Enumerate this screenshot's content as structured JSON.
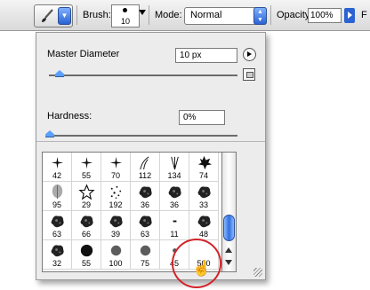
{
  "options_bar": {
    "brush_label": "Brush:",
    "brush_size": "10",
    "mode_label": "Mode:",
    "mode_value": "Normal",
    "opacity_label": "Opacity:",
    "opacity_value": "100%",
    "flow_label": "F"
  },
  "picker": {
    "master_diameter_label": "Master Diameter",
    "master_diameter_value": "10 px",
    "hardness_label": "Hardness:",
    "hardness_value": "0%"
  },
  "brushes": [
    {
      "num": "42",
      "kind": "star-small"
    },
    {
      "num": "55",
      "kind": "star-small"
    },
    {
      "num": "70",
      "kind": "star-small"
    },
    {
      "num": "112",
      "kind": "grass"
    },
    {
      "num": "134",
      "kind": "grass2"
    },
    {
      "num": "74",
      "kind": "leaf-maple"
    },
    {
      "num": "95",
      "kind": "leaf-round"
    },
    {
      "num": "29",
      "kind": "star-outline"
    },
    {
      "num": "192",
      "kind": "scatter"
    },
    {
      "num": "36",
      "kind": "blot"
    },
    {
      "num": "36",
      "kind": "blot"
    },
    {
      "num": "33",
      "kind": "blot"
    },
    {
      "num": "63",
      "kind": "blot"
    },
    {
      "num": "66",
      "kind": "blot"
    },
    {
      "num": "39",
      "kind": "blot"
    },
    {
      "num": "63",
      "kind": "blot"
    },
    {
      "num": "11",
      "kind": "dash"
    },
    {
      "num": "48",
      "kind": "blot"
    },
    {
      "num": "32",
      "kind": "blot"
    },
    {
      "num": "55",
      "kind": "circle-solid"
    },
    {
      "num": "100",
      "kind": "circle-soft"
    },
    {
      "num": "75",
      "kind": "circle-soft"
    },
    {
      "num": "45",
      "kind": "circle-tiny"
    },
    {
      "num": "500",
      "kind": "empty"
    }
  ]
}
